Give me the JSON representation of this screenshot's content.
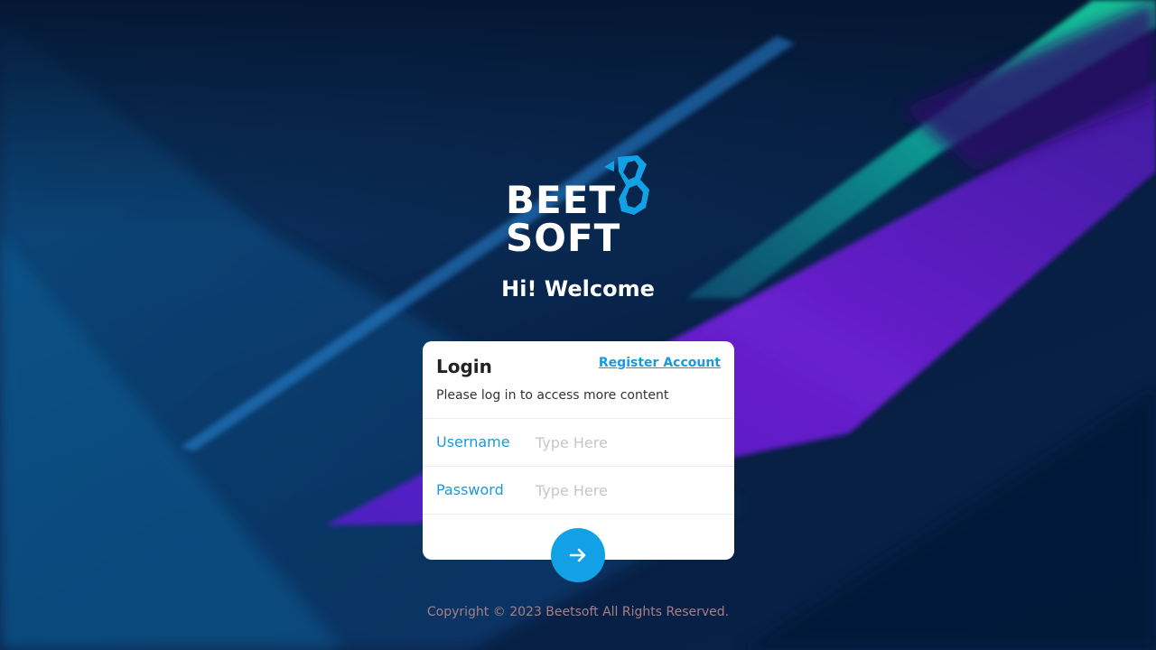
{
  "brand": {
    "line1": "BEET",
    "line2": "SOFT",
    "accent_color": "#12a1e4"
  },
  "welcome": "Hi! Welcome",
  "login_card": {
    "title": "Login",
    "register_link": "Register Account",
    "subtitle": "Please log in to access more content",
    "fields": {
      "username": {
        "label": "Username",
        "placeholder": "Type Here",
        "value": ""
      },
      "password": {
        "label": "Password",
        "placeholder": "Type Here",
        "value": ""
      }
    },
    "submit_icon": "arrow-right-icon"
  },
  "footer": {
    "copyright": "Copyright © 2023 Beetsoft All Rights Reserved."
  }
}
